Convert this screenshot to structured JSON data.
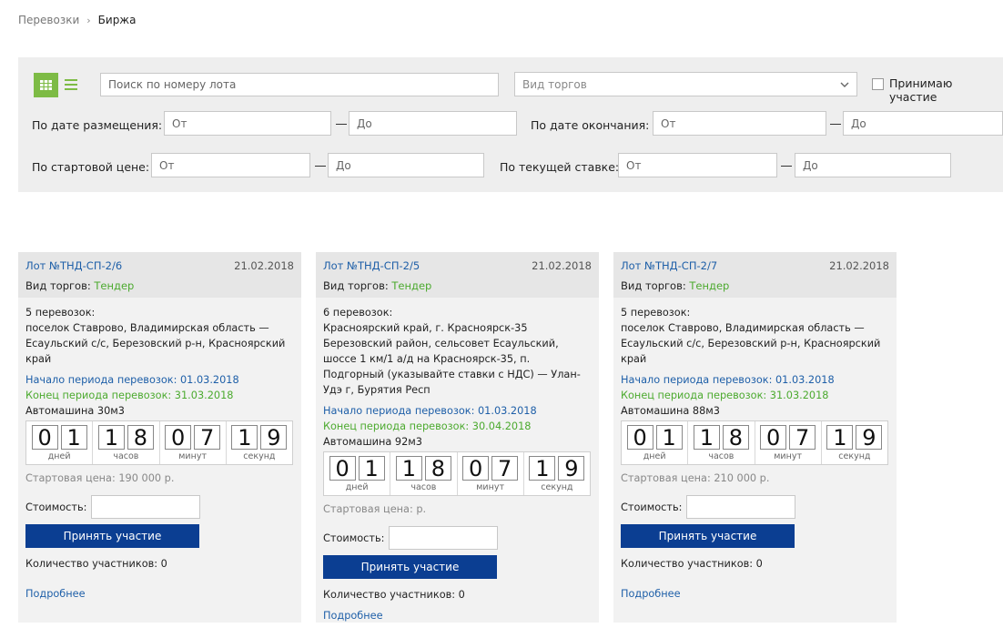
{
  "breadcrumb": {
    "parent": "Перевозки",
    "separator": "›",
    "current": "Биржа"
  },
  "filters": {
    "search_placeholder": "Поиск по номеру лота",
    "trade_type_placeholder": "Вид торгов",
    "participate_label": "Принимаю участие",
    "date_posted_label": "По дате размещения:",
    "date_end_label": "По дате окончания:",
    "start_price_label": "По стартовой цене:",
    "current_bid_label": "По текущей ставке:",
    "from_placeholder": "От",
    "to_placeholder": "До",
    "accent_color": "#7dbb45"
  },
  "timer_labels": {
    "days": "дней",
    "hours": "часов",
    "minutes": "минут",
    "seconds": "секунд"
  },
  "lots": [
    {
      "lot": "Лот №ТНД-СП-2/6",
      "date": "21.02.2018",
      "trade_label": "Вид торгов:",
      "trade_value": "Тендер",
      "count": "5 перевозок:",
      "route": "поселок Ставрово, Владимирская область — Есаульский с/с, Березовский р-н, Красноярский край",
      "start": "Начало периода перевозок: 01.03.2018",
      "end": "Конец периода перевозок: 31.03.2018",
      "vehicle": "Автомашина 30м3",
      "timer": {
        "d1": "0",
        "d2": "1",
        "h1": "1",
        "h2": "8",
        "m1": "0",
        "m2": "7",
        "s1": "1",
        "s2": "9"
      },
      "price": "Стартовая цена: 190 000 р.",
      "cost_label": "Стоимость:",
      "button": "Принять участие",
      "participants": "Количество участников: 0",
      "more": "Подробнее"
    },
    {
      "lot": "Лот №ТНД-СП-2/5",
      "date": "21.02.2018",
      "trade_label": "Вид торгов:",
      "trade_value": "Тендер",
      "count": "6 перевозок:",
      "route": "Красноярский край, г. Красноярск-35 Березовский район, сельсовет Есаульский, шоссе 1 км/1 а/д на Красноярск-35, п. Подгорный (указывайте ставки с НДС) — Улан-Удэ г, Бурятия Респ",
      "start": "Начало периода перевозок: 01.03.2018",
      "end": "Конец периода перевозок: 30.04.2018",
      "vehicle": "Автомашина 92м3",
      "timer": {
        "d1": "0",
        "d2": "1",
        "h1": "1",
        "h2": "8",
        "m1": "0",
        "m2": "7",
        "s1": "1",
        "s2": "9"
      },
      "price": "Стартовая цена: р.",
      "cost_label": "Стоимость:",
      "button": "Принять участие",
      "participants": "Количество участников: 0",
      "more": "Подробнее"
    },
    {
      "lot": "Лот №ТНД-СП-2/7",
      "date": "21.02.2018",
      "trade_label": "Вид торгов:",
      "trade_value": "Тендер",
      "count": "5 перевозок:",
      "route": "поселок Ставрово, Владимирская область — Есаульский с/с, Березовский р-н, Красноярский край",
      "start": "Начало периода перевозок: 01.03.2018",
      "end": "Конец периода перевозок: 31.03.2018",
      "vehicle": "Автомашина 88м3",
      "timer": {
        "d1": "0",
        "d2": "1",
        "h1": "1",
        "h2": "8",
        "m1": "0",
        "m2": "7",
        "s1": "1",
        "s2": "9"
      },
      "price": "Стартовая цена: 210 000 р.",
      "cost_label": "Стоимость:",
      "button": "Принять участие",
      "participants": "Количество участников: 0",
      "more": "Подробнее"
    }
  ]
}
